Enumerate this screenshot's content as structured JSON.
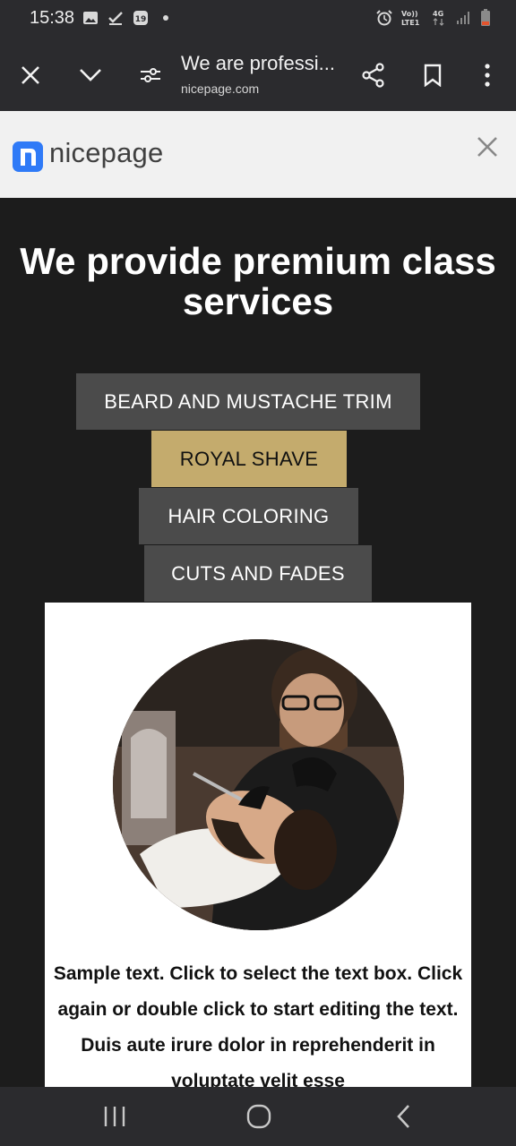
{
  "status_bar": {
    "time": "15:38",
    "icons_left": [
      "gallery-icon",
      "check-icon",
      "calendar-icon",
      "dot-icon"
    ],
    "icons_right": [
      "alarm-icon",
      "volte-icon",
      "4g-icon",
      "signal-icon",
      "battery-icon"
    ],
    "volte_label": "Vo)) LTE1",
    "network_label": "4G"
  },
  "browser": {
    "page_title": "We are professi...",
    "url": "nicepage.com"
  },
  "banner": {
    "logo_text": "nicepage"
  },
  "page": {
    "headline": "We provide premium class services",
    "tabs": [
      {
        "label": "BEARD AND MUSTACHE TRIM",
        "active": false
      },
      {
        "label": "ROYAL SHAVE",
        "active": true
      },
      {
        "label": "HAIR COLORING",
        "active": false
      },
      {
        "label": "CUTS AND FADES",
        "active": false
      }
    ],
    "card_text": "Sample text. Click to select the text box. Click again or double click to start editing the text. Duis aute irure dolor in reprehenderit in voluptate velit esse"
  },
  "colors": {
    "accent": "#c4ab6d",
    "tab_bg": "#4b4b4b",
    "page_bg": "#1c1c1c",
    "brand_blue": "#2f7af7"
  }
}
